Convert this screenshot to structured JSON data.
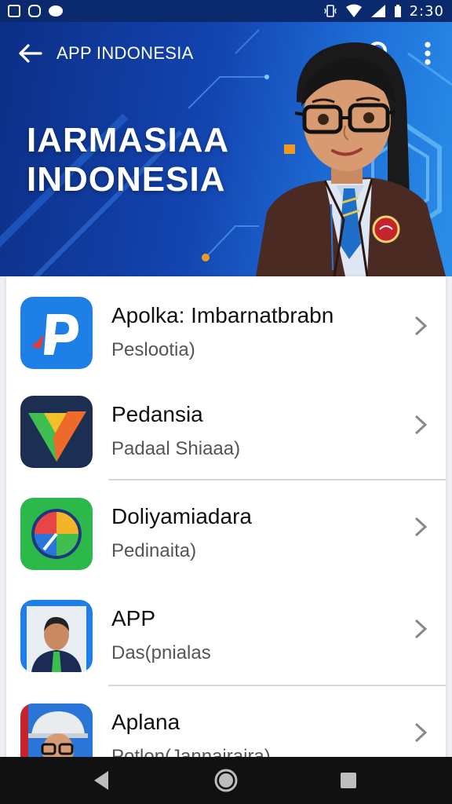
{
  "status_bar": {
    "time": "2:30",
    "left_icons": [
      "image-icon",
      "at-icon",
      "dot-icon"
    ],
    "right_icons": [
      "vibrate-icon",
      "wifi-icon",
      "signal-icon",
      "battery-icon"
    ]
  },
  "app_bar": {
    "title": "APP INDONESIA",
    "back_icon": "arrow-left-icon",
    "search_icon": "search-icon",
    "more_icon": "more-vert-icon"
  },
  "banner": {
    "heading_line1": "IARMASIAA",
    "heading_line2": "INDONESIA"
  },
  "list": {
    "items": [
      {
        "title": "Apolka: Imbarnatbrabn",
        "subtitle": "Peslootia)",
        "icon": "p-logo-icon"
      },
      {
        "title": "Pedansia",
        "subtitle": "Padaal Shiaaa)",
        "icon": "triangle-logo-icon"
      },
      {
        "title": "Doliyamiadara",
        "subtitle": "Pedinaita)",
        "icon": "compass-icon"
      },
      {
        "title": "APP",
        "subtitle": "Das(pnialas",
        "icon": "person-avatar-icon"
      },
      {
        "title": "Aplana",
        "subtitle": "Potlon(Jannairaira)",
        "icon": "worker-avatar-icon"
      }
    ]
  },
  "nav_bar": {
    "back": "back-triangle-icon",
    "home": "home-circle-icon",
    "recents": "recents-square-icon"
  },
  "colors": {
    "banner_dark": "#0c2f86",
    "banner_light": "#2a8fe8",
    "accent_orange": "#f39a1e"
  }
}
